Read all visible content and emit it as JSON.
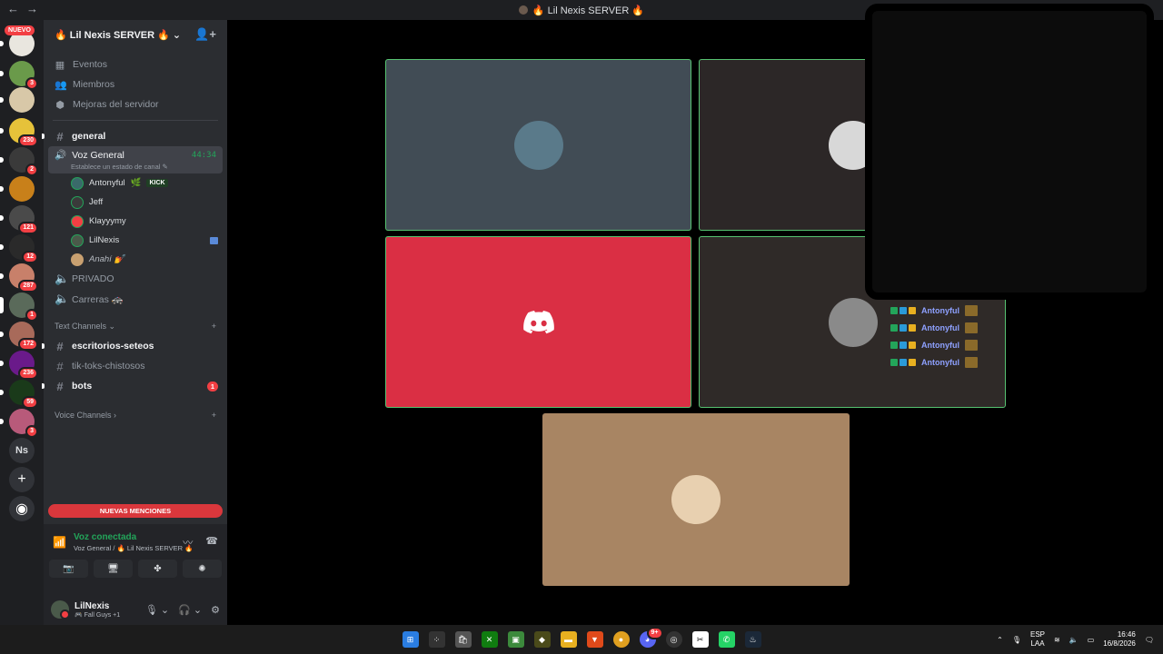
{
  "window": {
    "title": "🔥 Lil Nexis SERVER 🔥",
    "back": "←",
    "forward": "→"
  },
  "rail": {
    "nuevo": "NUEVO",
    "servers": [
      {
        "badge": "",
        "color": "#e9e6df"
      },
      {
        "badge": "3",
        "color": "#6a9a4a"
      },
      {
        "badge": "",
        "color": "#d8c8a8"
      },
      {
        "badge": "230",
        "color": "#e6c23a"
      },
      {
        "badge": "2",
        "color": "#3a3a3a"
      },
      {
        "badge": "",
        "color": "#c8801a"
      },
      {
        "badge": "121",
        "color": "#4a4a4a"
      },
      {
        "badge": "12",
        "color": "#2a2a2a"
      },
      {
        "badge": "287",
        "color": "#c8806a"
      },
      {
        "badge": "1",
        "color": "#5a6a5a"
      },
      {
        "badge": "172",
        "color": "#a86a5a"
      },
      {
        "badge": "236",
        "color": "#6a1a8a"
      },
      {
        "badge": "59",
        "color": "#1a3a1a"
      },
      {
        "badge": "3",
        "color": "#b85a7a"
      }
    ],
    "ns_label": "Ns",
    "add_label": "+",
    "explore_label": "◉"
  },
  "sidebar": {
    "server_name": "🔥 Lil Nexis SERVER 🔥",
    "chevron": "⌄",
    "menu": [
      {
        "label": "Eventos",
        "icon": "▦"
      },
      {
        "label": "Miembros",
        "icon": "👥"
      },
      {
        "label": "Mejoras del servidor",
        "icon": "⬢"
      }
    ],
    "channel_general": "general",
    "voice_general": {
      "name": "Voz General",
      "timer": "44:34",
      "status": "Establece un estado de canal ✎"
    },
    "voice_users": [
      {
        "name": "Antonyful",
        "extra": "🌿",
        "tag": "KICK",
        "color": "#3a6a6a"
      },
      {
        "name": "Jeff",
        "extra": "",
        "tag": "",
        "color": "#3a3a3a"
      },
      {
        "name": "Klayyymy",
        "extra": "",
        "tag": "",
        "color": "#f23f43"
      },
      {
        "name": "LilNexis",
        "extra": "",
        "tag": "",
        "color": "#4a5a4a"
      },
      {
        "name": "Anahí 💅",
        "extra": "",
        "tag": "",
        "color": "#c8a070"
      }
    ],
    "privado": "PRIVADO",
    "carreras": "Carreras 🚓",
    "text_category": "Text Channels",
    "text_channels": [
      {
        "name": "escritorios-seteos",
        "bright": true,
        "badge": ""
      },
      {
        "name": "tik-toks-chistosos",
        "bright": false,
        "badge": ""
      },
      {
        "name": "bots",
        "bright": true,
        "badge": "1"
      }
    ],
    "voice_category": "Voice Channels",
    "mentions_label": "NUEVAS MENCIONES"
  },
  "voice_panel": {
    "status": "Voz conectada",
    "location": "Voz General / 🔥 Lil Nexis SERVER 🔥",
    "buttons": [
      "📷",
      "🖥",
      "✤",
      "✺"
    ]
  },
  "user": {
    "name": "LilNexis",
    "activity": "🎮 Fall Guys +1"
  },
  "call": {
    "tiles": [
      {
        "bg": "#414c55",
        "avatar": "#5a7a8a"
      },
      {
        "bg": "#2c2727",
        "avatar": "#d8d8d8"
      },
      {
        "bg": "#da2f44",
        "avatar": ""
      },
      {
        "bg": "#2f2a28",
        "avatar": "#8a8a8a"
      },
      {
        "bg": "#a88563",
        "avatar": "#e8d0b0"
      }
    ],
    "mini_list_name": "Antonyful"
  },
  "taskbar": {
    "lang1": "ESP",
    "lang2": "LAA",
    "time": "16:46",
    "date": "16/8/2026",
    "discord_badge": "9+"
  }
}
